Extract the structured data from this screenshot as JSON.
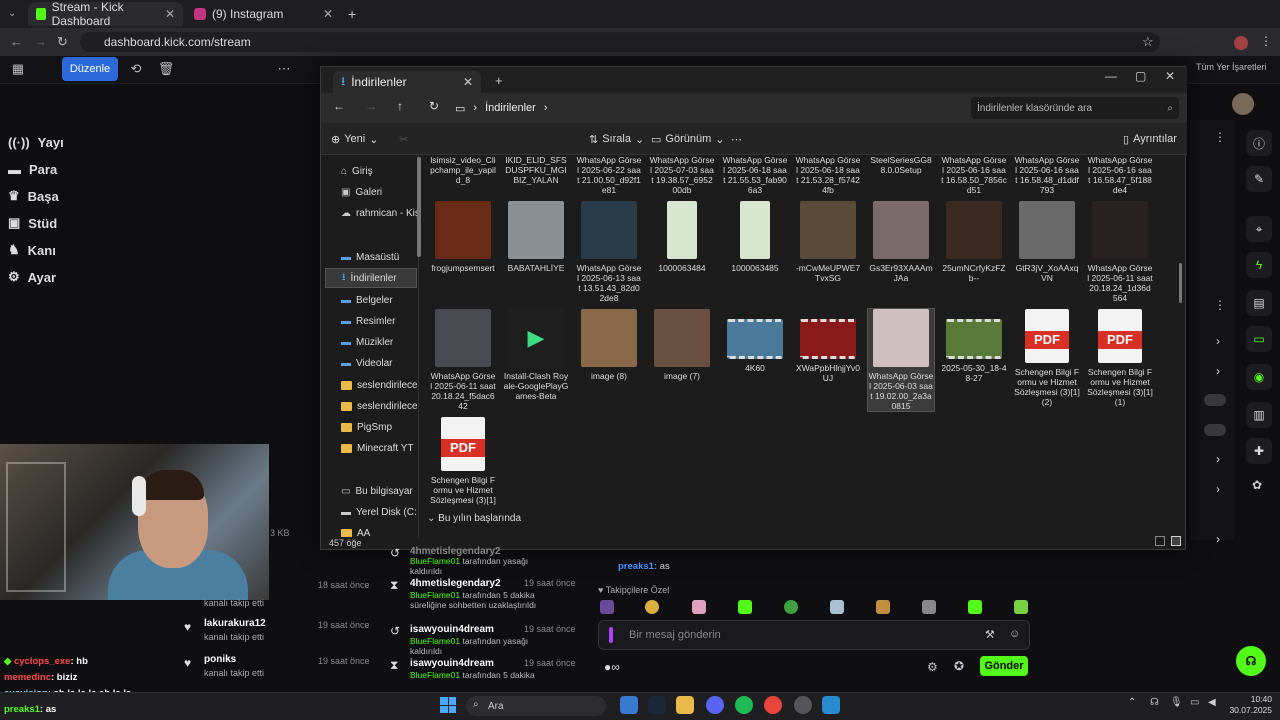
{
  "browser": {
    "tabs": [
      {
        "title": "Stream - Kick Dashboard"
      },
      {
        "title": "(9) Instagram"
      }
    ],
    "url": "dashboard.kick.com/stream",
    "bookmarks_label": "Tüm Yer İşaretleri"
  },
  "kick": {
    "toolbar": {
      "edit_label": "Düzenle"
    },
    "sidebar": [
      "Yayı",
      "Para",
      "Başa",
      "Stüd",
      "Kanı",
      "Ayar"
    ],
    "file_size_hint": "3 KB",
    "activity": [
      {
        "name": "",
        "sub": "kanalı takip etti",
        "time": "18 saat önce"
      },
      {
        "name": "lakurakura12",
        "sub": "kanalı takip etti",
        "time": "19 saat önce"
      },
      {
        "name": "poniks",
        "sub": "kanalı takip etti",
        "time": "19 saat önce"
      }
    ],
    "modlog": [
      {
        "name": "4hmetislegendary2",
        "who": "BlueFlame01",
        "text": "tarafından yasağı kaldırıldı",
        "time": ""
      },
      {
        "name": "4hmetislegendary2",
        "who": "BlueFlame01",
        "text": "tarafından 5 dakika süreliğine sohbetten uzaklaştırıldı",
        "time": "19 saat önce"
      },
      {
        "name": "isawyouin4dream",
        "who": "BlueFlame01",
        "text": "tarafından yasağı kaldırıldı",
        "time": "19 saat önce"
      },
      {
        "name": "isawyouin4dream",
        "who": "BlueFlame01",
        "text": "tarafından 5 dakika",
        "time": "19 saat önce"
      }
    ],
    "chat": {
      "last_user": "preaks1:",
      "last_msg": "as",
      "followers_only": "Takipçilere Özel",
      "placeholder": "Bir mesaj gönderin",
      "send": "Gönder"
    },
    "overlay_chat": [
      {
        "user": "cyclops_exe",
        "msg": ": hb",
        "color": "#ff4a4a"
      },
      {
        "user": "memedinc",
        "msg": ": biziz",
        "color": "#ff4a4a"
      },
      {
        "user": "eyovision",
        "msg": ": ah le le le ah le la",
        "color": "#8fd0ff"
      },
      {
        "user": "preaks1",
        "msg": ": as",
        "color": "#53fc18"
      }
    ]
  },
  "explorer": {
    "tab_title": "İndirilenler",
    "breadcrumb": "İndirilenler",
    "search_placeholder": "İndirilenler klasöründe ara",
    "commands": {
      "new": "Yeni",
      "sort": "Sırala",
      "view": "Görünüm",
      "details": "Ayrıntılar"
    },
    "nav": [
      {
        "label": "Giriş",
        "type": "home"
      },
      {
        "label": "Galeri",
        "type": "gallery"
      },
      {
        "label": "rahmican - Kişis",
        "type": "cloud"
      },
      {
        "label": "Masaüstü",
        "type": "folder-blue"
      },
      {
        "label": "İndirilenler",
        "type": "download",
        "selected": true
      },
      {
        "label": "Belgeler",
        "type": "folder-blue"
      },
      {
        "label": "Resimler",
        "type": "folder-blue"
      },
      {
        "label": "Müzikler",
        "type": "folder-blue"
      },
      {
        "label": "Videolar",
        "type": "folder-blue"
      },
      {
        "label": "seslendirilecek 2",
        "type": "folder"
      },
      {
        "label": "seslendirilecek 3",
        "type": "folder"
      },
      {
        "label": "PigSmp",
        "type": "folder"
      },
      {
        "label": "Minecraft YT",
        "type": "folder"
      },
      {
        "label": "Bu bilgisayar",
        "type": "pc"
      },
      {
        "label": "Yerel Disk (C:)",
        "type": "disk"
      },
      {
        "label": "AA",
        "type": "folder"
      }
    ],
    "row0": [
      "lsimsiz_video_Clipchamp_ile_yapild_8",
      "IKID_ELID_SFSDUSPFKU_MGIBIZ_YALAN",
      "WhatsApp Görsel 2025-06-22 saat 21.00.50_d92f1e81",
      "WhatsApp Görsel 2025-07-03 saat 19.38.57_695200db",
      "WhatsApp Görsel 2025-06-18 saat 21.55.53_fab906a3",
      "WhatsApp Görsel 2025-06-18 saat 21.53.28_f57424fb",
      "SteelSeriesGG88.0.0Setup",
      "WhatsApp Görsel 2025-06-16 saat 16.58.50_7856cd51",
      "WhatsApp Görsel 2025-06-16 saat 16.58.48_d1ddf793",
      "WhatsApp Görsel 2025-06-16 saat 16.58.47_5f188de4"
    ],
    "row1": [
      {
        "name": "frogjumpsemsert",
        "color": "#6a2a18"
      },
      {
        "name": "BABATAHLİYE",
        "color": "#8a8f93"
      },
      {
        "name": "WhatsApp Görsel 2025-06-13 saat 13.51.43_82d02de8",
        "color": "#2a3b4a"
      },
      {
        "name": "1000063484",
        "color": "#d8e6d0"
      },
      {
        "name": "1000063485",
        "color": "#d8e6d0"
      },
      {
        "name": "-mCwMeUPWE7TvxSG",
        "color": "#5a4a3a"
      },
      {
        "name": "Gs3Er93XAAAmJAa",
        "color": "#7a6a6a"
      },
      {
        "name": "25umNCrfyKzFZb--",
        "color": "#3a2a22"
      },
      {
        "name": "GtR3jV_XoAAxqVN",
        "color": "#6a6a6a"
      },
      {
        "name": "WhatsApp Görsel 2025-06-11 saat 20.18.24_1d36d564",
        "color": "#2a2222"
      }
    ],
    "row2": [
      {
        "name": "WhatsApp Görsel 2025-06-11 saat 20.18.24_f5dac642",
        "color": "#4a4a52",
        "kind": "img"
      },
      {
        "name": "Install-Clash Royale-GooglePlayGames-Beta",
        "color": "#1e1e1e",
        "kind": "gpg"
      },
      {
        "name": "image (8)",
        "color": "#8a6a4a",
        "kind": "img"
      },
      {
        "name": "image (7)",
        "color": "#6a5040",
        "kind": "img"
      },
      {
        "name": "4K60",
        "color": "#4a7a9a",
        "kind": "vid"
      },
      {
        "name": "XWaPpbHlnjjYv0UJ",
        "color": "#8a1a1a",
        "kind": "vid"
      },
      {
        "name": "WhatsApp Görsel 2025-06-03 saat 19.02.00_2a3a0815",
        "color": "#d0c0c0",
        "kind": "img",
        "selected": true
      },
      {
        "name": "2025-05-30_18-48-27",
        "color": "#5a7a3a",
        "kind": "vid"
      },
      {
        "name": "Schengen Bilgi Formu ve Hizmet Sözleşmesi (3)[1] (2)",
        "kind": "pdf"
      },
      {
        "name": "Schengen Bilgi Formu ve Hizmet Sözleşmesi (3)[1] (1)",
        "kind": "pdf"
      }
    ],
    "row3": [
      {
        "name": "Schengen Bilgi Formu ve Hizmet Sözleşmesi (3)[1]",
        "kind": "pdf"
      }
    ],
    "group_header": "Bu yılın başlarında",
    "item_count": "457 öğe",
    "pdf_label": "PDF"
  },
  "taskbar": {
    "search": "Ara",
    "time": "10:40",
    "date": "30.07.2025"
  },
  "colors": {
    "kick_green": "#53fc18",
    "folder": "#e9b949",
    "pdf_red": "#d93025"
  }
}
